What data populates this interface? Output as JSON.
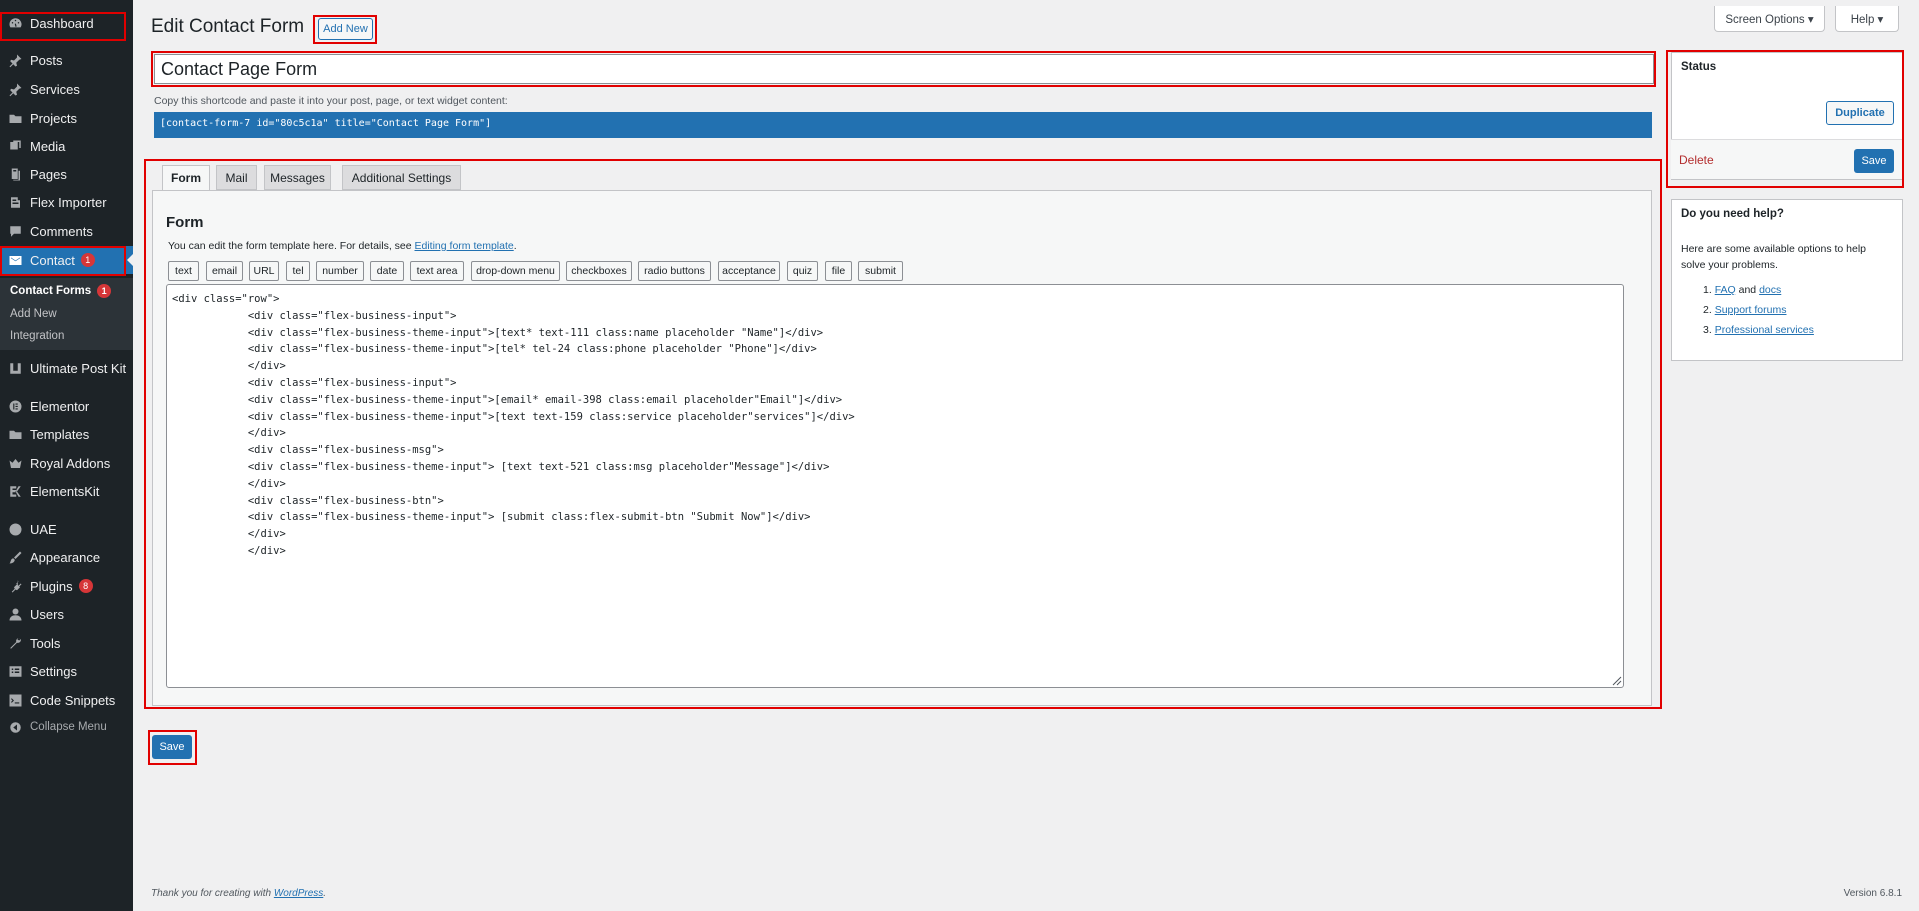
{
  "sidebar": {
    "items": [
      {
        "label": "Dashboard",
        "icon": "dashboard-icon"
      },
      {
        "label": "Posts",
        "icon": "pin-icon"
      },
      {
        "label": "Services",
        "icon": "pin-icon"
      },
      {
        "label": "Projects",
        "icon": "folder-icon"
      },
      {
        "label": "Media",
        "icon": "media-icon"
      },
      {
        "label": "Pages",
        "icon": "pages-icon"
      },
      {
        "label": "Flex Importer",
        "icon": "importer-icon"
      },
      {
        "label": "Comments",
        "icon": "comment-icon"
      },
      {
        "label": "Contact",
        "icon": "envelope-icon",
        "badge": "1"
      },
      {
        "label": "Ultimate Post Kit",
        "icon": "upk-icon"
      },
      {
        "label": "Elementor",
        "icon": "elementor-icon"
      },
      {
        "label": "Templates",
        "icon": "folder-icon"
      },
      {
        "label": "Royal Addons",
        "icon": "crown-icon"
      },
      {
        "label": "ElementsKit",
        "icon": "ek-icon"
      },
      {
        "label": "UAE",
        "icon": "uae-icon"
      },
      {
        "label": "Appearance",
        "icon": "brush-icon"
      },
      {
        "label": "Plugins",
        "icon": "plugin-icon",
        "badge": "8"
      },
      {
        "label": "Users",
        "icon": "user-icon"
      },
      {
        "label": "Tools",
        "icon": "wrench-icon"
      },
      {
        "label": "Settings",
        "icon": "settings-icon"
      },
      {
        "label": "Code Snippets",
        "icon": "code-icon"
      },
      {
        "label": "Collapse Menu",
        "icon": "collapse-icon"
      }
    ],
    "submenu": [
      {
        "label": "Contact Forms",
        "badge": "1"
      },
      {
        "label": "Add New"
      },
      {
        "label": "Integration"
      }
    ]
  },
  "header": {
    "title": "Edit Contact Form",
    "add_new": "Add New",
    "screen_options": "Screen Options ▾",
    "help": "Help ▾"
  },
  "form": {
    "title_value": "Contact Page Form",
    "shortcode_hint": "Copy this shortcode and paste it into your post, page, or text widget content:",
    "shortcode": "[contact-form-7 id=\"80c5c1a\" title=\"Contact Page Form\"]",
    "tabs": [
      "Form",
      "Mail",
      "Messages",
      "Additional Settings"
    ],
    "panel_heading": "Form",
    "panel_desc_prefix": "You can edit the form template here. For details, see ",
    "panel_desc_link": "Editing form template",
    "panel_desc_suffix": ".",
    "tag_buttons": [
      "text",
      "email",
      "URL",
      "tel",
      "number",
      "date",
      "text area",
      "drop-down menu",
      "checkboxes",
      "radio buttons",
      "acceptance",
      "quiz",
      "file",
      "submit"
    ],
    "code": "<div class=\"row\">\n            <div class=\"flex-business-input\">\n            <div class=\"flex-business-theme-input\">[text* text-111 class:name placeholder \"Name\"]</div>\n            <div class=\"flex-business-theme-input\">[tel* tel-24 class:phone placeholder \"Phone\"]</div>\n            </div>\n            <div class=\"flex-business-input\">\n            <div class=\"flex-business-theme-input\">[email* email-398 class:email placeholder\"Email\"]</div>\n            <div class=\"flex-business-theme-input\">[text text-159 class:service placeholder\"services\"]</div>\n            </div>\n            <div class=\"flex-business-msg\">\n            <div class=\"flex-business-theme-input\"> [text text-521 class:msg placeholder\"Message\"]</div>\n            </div>\n            <div class=\"flex-business-btn\">\n            <div class=\"flex-business-theme-input\"> [submit class:flex-submit-btn \"Submit Now\"]</div>\n            </div>\n            </div>",
    "save": "Save"
  },
  "status": {
    "title": "Status",
    "duplicate": "Duplicate",
    "delete": "Delete",
    "save": "Save"
  },
  "help_box": {
    "title": "Do you need help?",
    "text": "Here are some available options to help solve your problems.",
    "item1_num": "1.",
    "item1_a": "FAQ",
    "item1_and": "and",
    "item1_b": "docs",
    "item2_num": "2.",
    "item2": "Support forums",
    "item3_num": "3.",
    "item3": "Professional services"
  },
  "footer": {
    "thanks_prefix": "Thank you for creating with ",
    "thanks_link": "WordPress",
    "thanks_suffix": ".",
    "version": "Version 6.8.1"
  },
  "colors": {
    "sidebar_bg": "#1d2327",
    "accent": "#2271b1",
    "highlight_box": "#e10000",
    "badge": "#d63638"
  }
}
